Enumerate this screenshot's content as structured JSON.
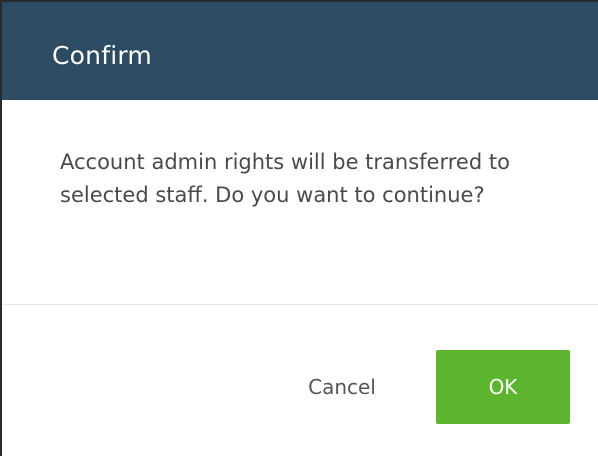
{
  "dialog": {
    "title": "Confirm",
    "message": "Account admin rights will be transferred to selected staff. Do you want to continue?",
    "buttons": {
      "cancel_label": "Cancel",
      "ok_label": "OK"
    }
  },
  "colors": {
    "header_bg": "#2e4b64",
    "header_text": "#ffffff",
    "message_text": "#4a4a4a",
    "ok_bg": "#5db42e",
    "ok_text": "#ffffff",
    "cancel_text": "#555555",
    "divider": "#e6e6e6"
  }
}
